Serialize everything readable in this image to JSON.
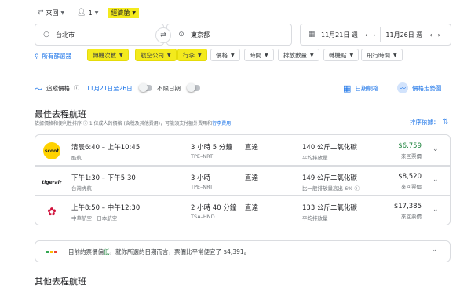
{
  "top_bar": {
    "trip_type": "來回",
    "passengers": "1",
    "cabin_class": "經濟艙"
  },
  "search": {
    "origin": "台北市",
    "destination": "東京都",
    "depart_date": "11月21日 週",
    "return_date": "11月26日 週"
  },
  "filters": {
    "all_filters": "所有篩選器",
    "stops": "轉機次數",
    "airlines": "航空公司",
    "bags": "行李",
    "price": "價格",
    "times": "時間",
    "emissions": "排放數量",
    "connecting_airports": "轉機點",
    "duration": "飛行時間"
  },
  "tracking": {
    "label": "追蹤價格",
    "dates": "11月21日至26日",
    "any_dates": "不限日期",
    "date_grid": "日期網格",
    "price_graph": "價格走勢圖"
  },
  "best": {
    "title": "最佳去程航班",
    "subtitle": "依據價格和便利性排序 ⓘ  1 位成人的價格 (含稅及其他費用)，可能須支付額外費用和",
    "link": "行李費用",
    "sort_label": "排序依據："
  },
  "flights": [
    {
      "logo_text": "scoot",
      "logo_bg": "#ffd200",
      "logo_color": "#202124",
      "times": "清晨6:40 – 上午10:45",
      "airline": "酷航",
      "duration": "3 小時 5 分鐘",
      "route": "TPE–NRT",
      "stops": "直達",
      "emissions": "140 公斤二氧化碳",
      "emissions_note": "平均排放量",
      "price": "$6,759",
      "price_color": "#188038",
      "price_note": "來回票價"
    },
    {
      "logo_text": "tigerair",
      "logo_bg": "#ffffff",
      "logo_color": "#202124",
      "times": "下午1:30 – 下午5:30",
      "airline": "台灣虎航",
      "duration": "3 小時",
      "route": "TPE–NRT",
      "stops": "直達",
      "emissions": "149 公斤二氧化碳",
      "emissions_note": "比一般排放量高出 6% ⓘ",
      "price": "$8,520",
      "price_color": "#202124",
      "price_note": "來回票價"
    },
    {
      "logo_text": "✿",
      "logo_bg": "#ffffff",
      "logo_color": "#d0103a",
      "times": "上午8:50 – 中午12:30",
      "airline": "中華航空 · 日本航空",
      "duration": "2 小時 40 分鐘",
      "route": "TSA–HND",
      "stops": "直達",
      "emissions": "133 公斤二氧化碳",
      "emissions_note": "平均排放量",
      "price": "$17,385",
      "price_color": "#202124",
      "price_note": "來回票價"
    }
  ],
  "price_insight": {
    "text_before": "目前的票價偏",
    "low": "低",
    "text_after": "，就你所選的日期而言，票價比平常便宜了 $4,391。",
    "low_color": "#188038"
  },
  "other": {
    "title": "其他去程航班"
  },
  "colors": {
    "highlight": "#f3ea1d",
    "accent": "#1a73e8",
    "price_green": "#188038"
  }
}
